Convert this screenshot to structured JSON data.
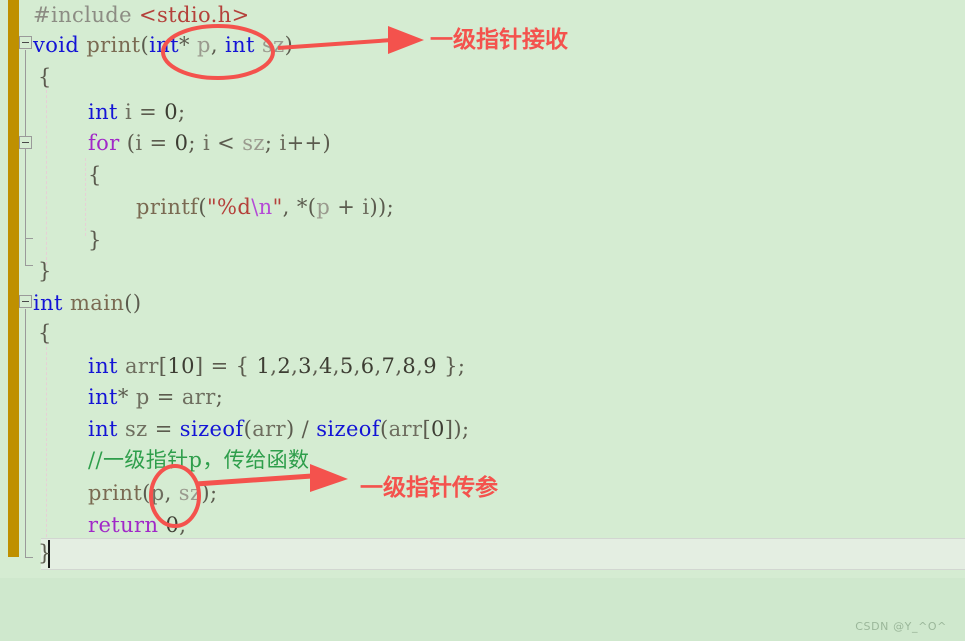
{
  "editor": {
    "background_color": "#d5ecd2",
    "page_background_color": "#cfe8cd",
    "change_bar_color": "#bf9000",
    "current_line_background": "#e4eee2",
    "caret_color": "#1a1a1a",
    "language": "C"
  },
  "code": {
    "lines": [
      {
        "index": 0,
        "indent": 0,
        "tokens": [
          {
            "text": "#include ",
            "kind": "preprocessor"
          },
          {
            "text": "<stdio.h>",
            "kind": "header"
          }
        ]
      },
      {
        "index": 1,
        "indent": 0,
        "tokens": [
          {
            "text": "void ",
            "kind": "keyword"
          },
          {
            "text": "print",
            "kind": "function"
          },
          {
            "text": "(",
            "kind": "punct"
          },
          {
            "text": "int",
            "kind": "keyword"
          },
          {
            "text": "* ",
            "kind": "punct"
          },
          {
            "text": "p",
            "kind": "dim-id"
          },
          {
            "text": ", ",
            "kind": "punct"
          },
          {
            "text": "int",
            "kind": "keyword"
          },
          {
            "text": " ",
            "kind": "punct"
          },
          {
            "text": "sz",
            "kind": "dim-id"
          },
          {
            "text": ")",
            "kind": "punct"
          }
        ]
      },
      {
        "index": 2,
        "indent": 1,
        "tokens": [
          {
            "text": "{",
            "kind": "punct"
          }
        ]
      },
      {
        "index": 3,
        "indent": 2,
        "tokens": [
          {
            "text": "int",
            "kind": "keyword"
          },
          {
            "text": " ",
            "kind": "punct"
          },
          {
            "text": "i",
            "kind": "id"
          },
          {
            "text": " = ",
            "kind": "punct"
          },
          {
            "text": "0",
            "kind": "number"
          },
          {
            "text": ";",
            "kind": "punct"
          }
        ]
      },
      {
        "index": 4,
        "indent": 2,
        "tokens": [
          {
            "text": "for",
            "kind": "keyword2"
          },
          {
            "text": " (",
            "kind": "punct"
          },
          {
            "text": "i",
            "kind": "id"
          },
          {
            "text": " = ",
            "kind": "punct"
          },
          {
            "text": "0",
            "kind": "number"
          },
          {
            "text": "; ",
            "kind": "punct"
          },
          {
            "text": "i",
            "kind": "id"
          },
          {
            "text": " < ",
            "kind": "punct"
          },
          {
            "text": "sz",
            "kind": "dim-id"
          },
          {
            "text": "; ",
            "kind": "punct"
          },
          {
            "text": "i",
            "kind": "id"
          },
          {
            "text": "++)",
            "kind": "punct"
          }
        ]
      },
      {
        "index": 5,
        "indent": 3,
        "tokens": [
          {
            "text": "{",
            "kind": "punct"
          }
        ]
      },
      {
        "index": 6,
        "indent": 4,
        "tokens": [
          {
            "text": "printf",
            "kind": "function"
          },
          {
            "text": "(",
            "kind": "punct"
          },
          {
            "text": "\"%d",
            "kind": "string"
          },
          {
            "text": "\\n",
            "kind": "escape"
          },
          {
            "text": "\"",
            "kind": "string"
          },
          {
            "text": ", *(",
            "kind": "punct"
          },
          {
            "text": "p",
            "kind": "dim-id"
          },
          {
            "text": " + ",
            "kind": "punct"
          },
          {
            "text": "i",
            "kind": "id"
          },
          {
            "text": "));",
            "kind": "punct"
          }
        ]
      },
      {
        "index": 7,
        "indent": 3,
        "tokens": [
          {
            "text": "}",
            "kind": "punct"
          }
        ]
      },
      {
        "index": 8,
        "indent": 1,
        "tokens": [
          {
            "text": "}",
            "kind": "punct"
          }
        ]
      },
      {
        "index": 9,
        "indent": 0,
        "tokens": [
          {
            "text": "int",
            "kind": "keyword"
          },
          {
            "text": " ",
            "kind": "punct"
          },
          {
            "text": "main",
            "kind": "function"
          },
          {
            "text": "()",
            "kind": "punct"
          }
        ]
      },
      {
        "index": 10,
        "indent": 1,
        "tokens": [
          {
            "text": "{",
            "kind": "punct"
          }
        ]
      },
      {
        "index": 11,
        "indent": 2,
        "tokens": [
          {
            "text": "int",
            "kind": "keyword"
          },
          {
            "text": " ",
            "kind": "punct"
          },
          {
            "text": "arr",
            "kind": "id"
          },
          {
            "text": "[",
            "kind": "punct"
          },
          {
            "text": "10",
            "kind": "number"
          },
          {
            "text": "] = { ",
            "kind": "punct"
          },
          {
            "text": "1",
            "kind": "number"
          },
          {
            "text": ",",
            "kind": "punct"
          },
          {
            "text": "2",
            "kind": "number"
          },
          {
            "text": ",",
            "kind": "punct"
          },
          {
            "text": "3",
            "kind": "number"
          },
          {
            "text": ",",
            "kind": "punct"
          },
          {
            "text": "4",
            "kind": "number"
          },
          {
            "text": ",",
            "kind": "punct"
          },
          {
            "text": "5",
            "kind": "number"
          },
          {
            "text": ",",
            "kind": "punct"
          },
          {
            "text": "6",
            "kind": "number"
          },
          {
            "text": ",",
            "kind": "punct"
          },
          {
            "text": "7",
            "kind": "number"
          },
          {
            "text": ",",
            "kind": "punct"
          },
          {
            "text": "8",
            "kind": "number"
          },
          {
            "text": ",",
            "kind": "punct"
          },
          {
            "text": "9",
            "kind": "number"
          },
          {
            "text": " };",
            "kind": "punct"
          }
        ]
      },
      {
        "index": 12,
        "indent": 2,
        "tokens": [
          {
            "text": "int",
            "kind": "keyword"
          },
          {
            "text": "* ",
            "kind": "punct"
          },
          {
            "text": "p",
            "kind": "id"
          },
          {
            "text": " = ",
            "kind": "punct"
          },
          {
            "text": "arr",
            "kind": "id"
          },
          {
            "text": ";",
            "kind": "punct"
          }
        ]
      },
      {
        "index": 13,
        "indent": 2,
        "tokens": [
          {
            "text": "int",
            "kind": "keyword"
          },
          {
            "text": " ",
            "kind": "punct"
          },
          {
            "text": "sz",
            "kind": "id"
          },
          {
            "text": " = ",
            "kind": "punct"
          },
          {
            "text": "sizeof",
            "kind": "keyword"
          },
          {
            "text": "(",
            "kind": "punct"
          },
          {
            "text": "arr",
            "kind": "id"
          },
          {
            "text": ") / ",
            "kind": "punct"
          },
          {
            "text": "sizeof",
            "kind": "keyword"
          },
          {
            "text": "(",
            "kind": "punct"
          },
          {
            "text": "arr",
            "kind": "id"
          },
          {
            "text": "[",
            "kind": "punct"
          },
          {
            "text": "0",
            "kind": "number"
          },
          {
            "text": "]);",
            "kind": "punct"
          }
        ]
      },
      {
        "index": 14,
        "indent": 2,
        "tokens": [
          {
            "text": "//一级指针p，传给函数",
            "kind": "comment"
          }
        ]
      },
      {
        "index": 15,
        "indent": 2,
        "tokens": [
          {
            "text": "print",
            "kind": "function"
          },
          {
            "text": "(",
            "kind": "punct"
          },
          {
            "text": "p",
            "kind": "id"
          },
          {
            "text": ", ",
            "kind": "punct"
          },
          {
            "text": "sz",
            "kind": "dim-id"
          },
          {
            "text": ");",
            "kind": "punct"
          }
        ]
      },
      {
        "index": 16,
        "indent": 2,
        "tokens": [
          {
            "text": "return",
            "kind": "keyword2"
          },
          {
            "text": " ",
            "kind": "punct"
          },
          {
            "text": "0",
            "kind": "number"
          },
          {
            "text": ";",
            "kind": "punct"
          }
        ]
      },
      {
        "index": 17,
        "indent": 1,
        "tokens": [
          {
            "text": "}",
            "kind": "punct"
          }
        ]
      }
    ]
  },
  "annotations": {
    "color": "#f4524d",
    "items": [
      {
        "id": "param-receive",
        "label": "一级指针接收",
        "circled_code": "(int* p,",
        "arrow_direction": "right"
      },
      {
        "id": "param-pass",
        "label": "一级指针传参",
        "circled_code": "(p,",
        "arrow_direction": "right"
      }
    ]
  },
  "watermark": {
    "text": "CSDN @Y_^O^"
  }
}
